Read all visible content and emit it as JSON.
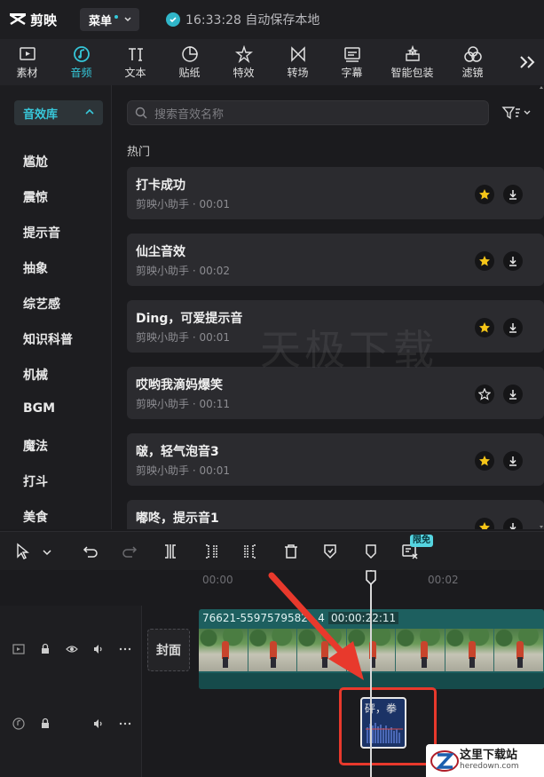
{
  "app": {
    "name": "剪映",
    "menu_label": "菜单",
    "autosave": "16:33:28 自动保存本地"
  },
  "toolbar": [
    {
      "label": "素材",
      "icon": "media-icon"
    },
    {
      "label": "音频",
      "icon": "audio-icon",
      "active": true
    },
    {
      "label": "文本",
      "icon": "text-icon"
    },
    {
      "label": "贴纸",
      "icon": "sticker-icon"
    },
    {
      "label": "特效",
      "icon": "effects-icon"
    },
    {
      "label": "转场",
      "icon": "transition-icon"
    },
    {
      "label": "字幕",
      "icon": "subtitle-icon"
    },
    {
      "label": "智能包装",
      "icon": "smart-pack-icon"
    },
    {
      "label": "滤镜",
      "icon": "filter-icon"
    }
  ],
  "sidebar": {
    "header": "音效库",
    "items": [
      "尴尬",
      "震惊",
      "提示音",
      "抽象",
      "综艺感",
      "知识科普",
      "机械",
      "BGM",
      "魔法",
      "打斗",
      "美食"
    ]
  },
  "search": {
    "placeholder": "搜索音效名称"
  },
  "section_title": "热门",
  "sounds": [
    {
      "title": "打卡成功",
      "meta": "剪映小助手 · 00:01",
      "favorited": true
    },
    {
      "title": "仙尘音效",
      "meta": "剪映小助手 · 00:02",
      "favorited": true
    },
    {
      "title": "Ding，可爱提示音",
      "meta": "剪映小助手 · 00:01",
      "favorited": true
    },
    {
      "title": "哎哟我滴妈爆笑",
      "meta": "剪映小助手 · 00:11",
      "favorited": false
    },
    {
      "title": "啵，轻气泡音3",
      "meta": "剪映小助手 · 00:01",
      "favorited": true
    },
    {
      "title": "嘟咚，提示音1",
      "meta": "",
      "favorited": true
    }
  ],
  "watermark_text": "天极下载",
  "edit_toolbar": {
    "badge": "限免"
  },
  "timeline": {
    "ruler": [
      "00:00",
      "00:02"
    ],
    "cover_label": "封面",
    "video_clip": {
      "name": "76621-5597579582...4",
      "duration": "00:00:22:11"
    },
    "audio_clip": {
      "label": "砰，拳"
    }
  },
  "site_logo": {
    "cn": "这里下载站",
    "en": "heredown.com"
  },
  "colors": {
    "accent": "#35c6d8",
    "panel": "#2b2b2f",
    "highlight": "#e8392c",
    "star": "#f5c518"
  }
}
